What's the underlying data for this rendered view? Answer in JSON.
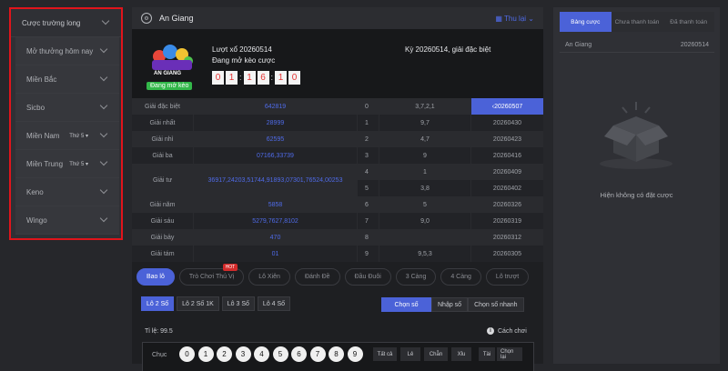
{
  "sidebar": {
    "items": [
      {
        "label": "Cược trường long",
        "tag": ""
      },
      {
        "label": "Mở thưởng hôm nay",
        "tag": ""
      },
      {
        "label": "Miền Bắc",
        "tag": ""
      },
      {
        "label": "Sicbo",
        "tag": ""
      },
      {
        "label": "Miền Nam",
        "tag": "Thứ 5"
      },
      {
        "label": "Miền Trung",
        "tag": "Thứ 5"
      },
      {
        "label": "Keno",
        "tag": ""
      },
      {
        "label": "Wingo",
        "tag": ""
      }
    ]
  },
  "header": {
    "title": "An Giang",
    "history": "Thu lại"
  },
  "draw": {
    "logo_text": "AN GIANG",
    "status_badge": "Đang mở kèo",
    "round_label": "Lượt xổ 20260514",
    "open_label": "Đang mở kèo cược",
    "timer": [
      "0",
      "1",
      "1",
      "6",
      "1",
      "0"
    ],
    "period_text": "Kỳ 20260514, giải đặc biệt"
  },
  "results": [
    {
      "prize": "Giải đặc biệt",
      "value": "642819",
      "head": "0",
      "tail": "3,7,2,1",
      "date": "20260507"
    },
    {
      "prize": "Giải nhất",
      "value": "28999",
      "head": "1",
      "tail": "9,7",
      "date": "20260430"
    },
    {
      "prize": "Giải nhì",
      "value": "62595",
      "head": "2",
      "tail": "4,7",
      "date": "20260423"
    },
    {
      "prize": "Giải ba",
      "value": "07166,33739",
      "head": "3",
      "tail": "9",
      "date": "20260416"
    },
    {
      "prize": "Giải tư",
      "value": "36917,24203,51744,91893,07301,76524,00253",
      "head": "4",
      "tail": "1",
      "date": "20260409"
    },
    {
      "prize": "",
      "value": "",
      "head": "5",
      "tail": "3,8",
      "date": "20260402"
    },
    {
      "prize": "Giải năm",
      "value": "5858",
      "head": "6",
      "tail": "5",
      "date": "20260326"
    },
    {
      "prize": "Giải sáu",
      "value": "5279,7627,8102",
      "head": "7",
      "tail": "9,0",
      "date": "20260319"
    },
    {
      "prize": "Giải bảy",
      "value": "470",
      "head": "8",
      "tail": "",
      "date": "20260312"
    },
    {
      "prize": "Giải tám",
      "value": "01",
      "head": "9",
      "tail": "9,5,3",
      "date": "20260305"
    }
  ],
  "bet_tabs": [
    "Bao lô",
    "Trò Chơi Thú Vị",
    "Lô Xiên",
    "Đánh Đề",
    "Đầu Đuôi",
    "3 Càng",
    "4 Càng",
    "Lô trượt"
  ],
  "hot_label": "HOT",
  "sub_tabs": [
    "Lô 2 Số",
    "Lô 2 Số 1K",
    "Lô 3 Số",
    "Lô 4 Số"
  ],
  "modes": [
    "Chọn số",
    "Nhập số",
    "Chọn số nhanh"
  ],
  "ratio_label": "Tỉ lệ:",
  "ratio_value": "99.5",
  "howto": "Cách chơi",
  "number_row": {
    "label": "Chục",
    "numbers": [
      "0",
      "1",
      "2",
      "3",
      "4",
      "5",
      "6",
      "7",
      "8",
      "9"
    ],
    "quick": [
      "Tất cả",
      "Lẻ",
      "Chẵn",
      "Xỉu",
      "Tài",
      "Chọn lại"
    ]
  },
  "right_panel": {
    "tabs": [
      "Bảng cược",
      "Chưa thanh toán",
      "Đã thanh toán"
    ],
    "lottery": "An Giang",
    "period": "20260514",
    "empty_text": "Hiện không có đặt cược"
  }
}
